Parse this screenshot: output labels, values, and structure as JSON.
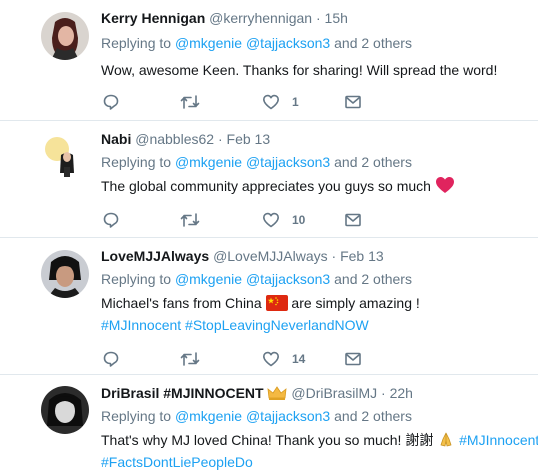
{
  "tweets": [
    {
      "name": "Kerry Hennigan",
      "handle": "@kerryhennigan",
      "dot": "·",
      "time": "15h",
      "replying_prefix": "Replying to",
      "mention1": "@mkgenie",
      "mention2": "@tajjackson3",
      "replying_suffix": "and 2 others",
      "text": "Wow, awesome Keen.  Thanks for sharing!  Will spread the word!",
      "likes": "1"
    },
    {
      "name": "Nabi",
      "handle": "@nabbles62",
      "dot": "·",
      "time": "Feb 13",
      "replying_prefix": "Replying to",
      "mention1": "@mkgenie",
      "mention2": "@tajjackson3",
      "replying_suffix": "and 2 others",
      "text": "The global community appreciates you guys so much",
      "likes": "10"
    },
    {
      "name": "LoveMJJAlways",
      "handle": "@LoveMJJAlways",
      "dot": "·",
      "time": "Feb 13",
      "replying_prefix": "Replying to",
      "mention1": "@mkgenie",
      "mention2": "@tajjackson3",
      "replying_suffix": "and 2 others",
      "text_before": "Michael's fans from China",
      "text_after": "are simply amazing !",
      "hashtags": "#MJInnocent #StopLeavingNeverlandNOW",
      "likes": "14"
    },
    {
      "name": "DriBrasil #MJINNOCENT",
      "handle": "@DriBrasilMJ",
      "dot": "·",
      "time": "22h",
      "replying_prefix": "Replying to",
      "mention1": "@mkgenie",
      "mention2": "@tajjackson3",
      "replying_suffix": "and 2 others",
      "text_before": "That's why MJ loved China! Thank you so much! 謝謝",
      "hashtag_inline": "#MJInnocent",
      "hashtags_line2": "#FactsDontLiePeopleDo"
    }
  ],
  "colors": {
    "link": "#1da1f2",
    "muted": "#657786",
    "divider": "#e1e8ed",
    "heart": "#e0245e"
  }
}
